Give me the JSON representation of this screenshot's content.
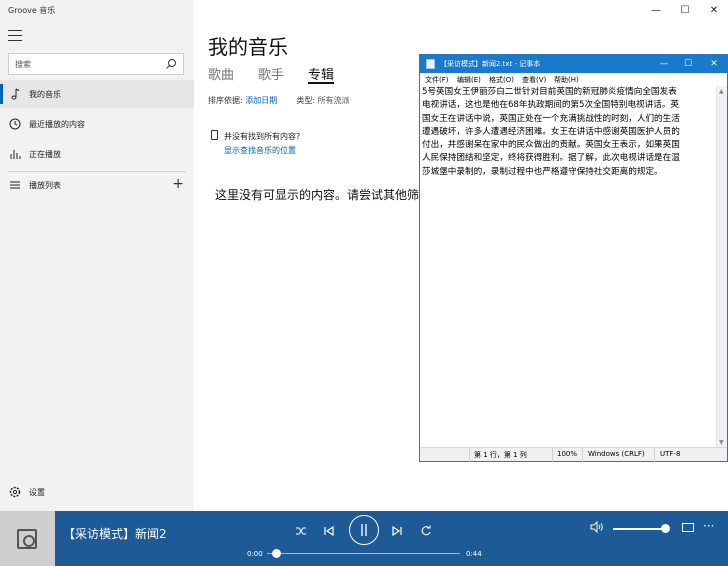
{
  "groove": {
    "app_title": "Groove 音乐",
    "search_placeholder": "搜索",
    "nav": {
      "my_music": "我的音乐",
      "recent": "最近播放的内容",
      "now_playing": "正在播放",
      "playlists": "播放列表",
      "settings": "设置"
    },
    "page_title": "我的音乐",
    "tabs": [
      "歌曲",
      "歌手",
      "专辑"
    ],
    "sort_label": "排序依据:",
    "sort_value": "添加日期",
    "type_label": "类型:",
    "type_value": "所有流派",
    "notice_text": "并没有找到所有内容?",
    "notice_link": "显示查找音乐的位置",
    "empty_text": "这里没有可显示的内容。请尝试其他筛"
  },
  "player": {
    "track_title": "【采访模式】新闻2",
    "time_current": "0:00",
    "time_total": "0:44",
    "progress_fraction": 0.0,
    "volume_fraction": 1.0
  },
  "notepad": {
    "title": "【采访模式】新闻2.txt - 记事本",
    "menus": [
      "文件(F)",
      "编辑(E)",
      "格式(O)",
      "查看(V)",
      "帮助(H)"
    ],
    "content": "5号英国女王伊丽莎白二世针对目前英国的新冠肺炎疫情向全国发表\n电视讲话，这也是他在68年执政期间的第5次全国特别电视讲话。英\n国女王在讲话中说，英国正处在一个充满挑战性的时刻，人们的生活\n遭遇破坏，许多人遭遇经济困难。女王在讲话中感谢英国医护人员的\n付出，并感谢呆在家中的民众做出的贡献。英国女王表示，如果英国\n人民保持团结和坚定，终将获得胜利。据了解，此次电视讲话是在温\n莎城堡中录制的，录制过程中也严格遵守保持社交距离的规定。",
    "status_position": "第 1 行，第 1 列",
    "status_zoom": "100%",
    "status_eol": "Windows (CRLF)",
    "status_encoding": "UTF-8"
  },
  "colors": {
    "accent": "#0063b1",
    "player_bar": "#1e5b96",
    "notepad_titlebar": "#1979ca"
  }
}
